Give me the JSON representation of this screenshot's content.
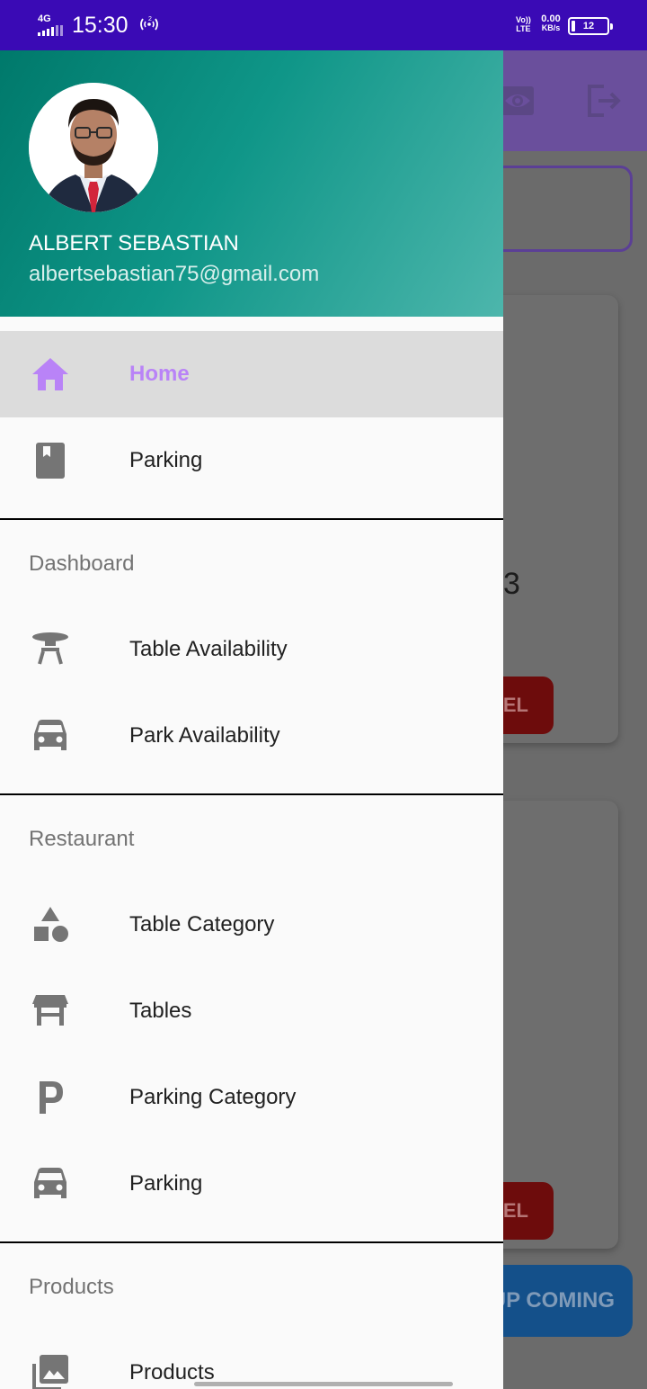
{
  "status_bar": {
    "network": "4G",
    "time": "15:30",
    "hotspot_count": "2",
    "volte_top": "Vo))",
    "volte_bottom": "LTE",
    "speed_value": "0.00",
    "speed_unit": "KB/s",
    "battery_level": "12"
  },
  "drawer": {
    "user_name": "ALBERT SEBASTIAN",
    "user_email": "albertsebastian75@gmail.com",
    "items": [
      {
        "label": "Home",
        "icon": "home-icon",
        "active": true
      },
      {
        "label": "Parking",
        "icon": "bookmark-icon"
      }
    ],
    "sections": [
      {
        "title": "Dashboard",
        "items": [
          {
            "label": "Table Availability",
            "icon": "table-restaurant-icon"
          },
          {
            "label": "Park Availability",
            "icon": "car-icon"
          }
        ]
      },
      {
        "title": "Restaurant",
        "items": [
          {
            "label": "Table Category",
            "icon": "category-icon"
          },
          {
            "label": "Tables",
            "icon": "table-bar-icon"
          },
          {
            "label": "Parking Category",
            "icon": "parking-p-icon"
          },
          {
            "label": "Parking",
            "icon": "car-icon"
          }
        ]
      },
      {
        "title": "Products",
        "items": [
          {
            "label": "Products",
            "icon": "photo-library-icon"
          }
        ]
      }
    ],
    "accent_color": "#b983f7",
    "header_gradient": [
      "#00796b",
      "#4db6ac"
    ]
  },
  "background_app": {
    "partial_value": "3",
    "cancel_fragment": "EL",
    "upcoming_fragment": "UP COMING",
    "toolbar_color": "#6a4f9c",
    "button_color": "#6d0c0c",
    "upcoming_color": "#14508a"
  }
}
